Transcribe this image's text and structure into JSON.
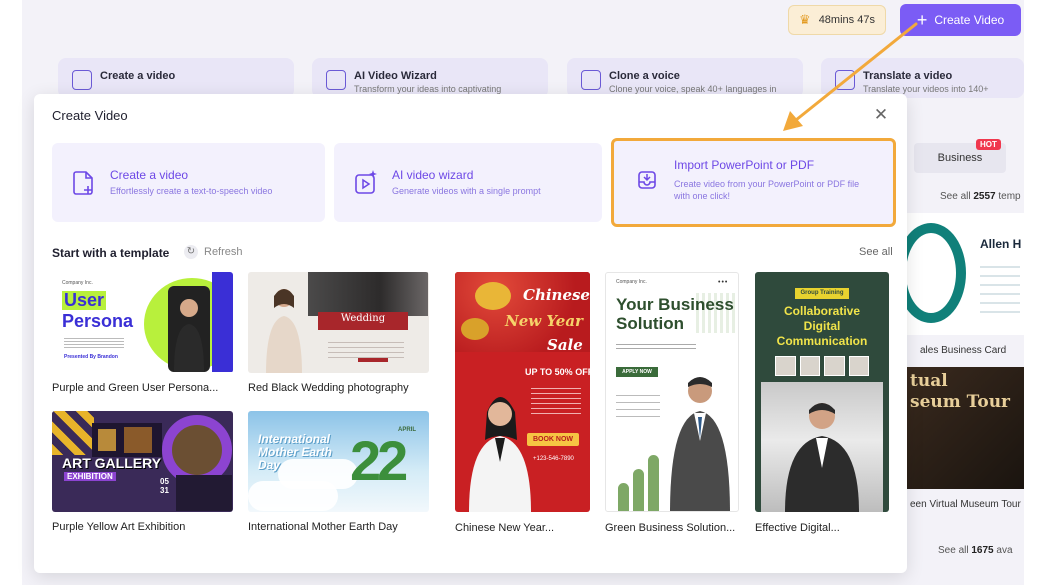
{
  "header": {
    "credits_label": "48mins 47s",
    "create_button_label": "Create Video"
  },
  "background_cards": [
    {
      "title": "Create a video",
      "subtitle": ""
    },
    {
      "title": "AI Video Wizard",
      "subtitle": "Transform your ideas into captivating"
    },
    {
      "title": "Clone a voice",
      "subtitle": "Clone your voice, speak 40+ languages in"
    },
    {
      "title": "Translate a video",
      "subtitle": "Translate your videos into 140+"
    }
  ],
  "background_right": {
    "tab_label": "Business",
    "hot_badge": "HOT",
    "see_all_prefix": "See all",
    "see_all_count": "2557",
    "see_all_suffix": "temp",
    "card1_name": "Allen H",
    "card1_caption": "ales Business Card",
    "card2_text": "tual\nseum Tour",
    "card2_caption": "een Virtual Museum Tour",
    "see_all2_prefix": "See all",
    "see_all2_count": "1675",
    "see_all2_suffix": "ava"
  },
  "modal": {
    "title": "Create Video",
    "options": [
      {
        "title": "Create a video",
        "subtitle": "Effortlessly create a text-to-speech video",
        "icon": "document-plus-icon"
      },
      {
        "title": "AI video wizard",
        "subtitle": "Generate videos with a single prompt",
        "icon": "magic-video-icon"
      },
      {
        "title": "Import PowerPoint or PDF",
        "subtitle": "Create video from your PowerPoint or PDF file with one click!",
        "icon": "import-tray-icon"
      }
    ],
    "section_title": "Start with a template",
    "refresh_label": "Refresh",
    "see_all_label": "See all",
    "templates": [
      {
        "caption": "Purple and Green User Persona...",
        "thumb": {
          "small": "Company Inc.",
          "line1": "User",
          "line2": "Persona",
          "presenter": "Presented By Brandon"
        }
      },
      {
        "caption": "Red Black Wedding photography",
        "thumb": {
          "band": "Wedding"
        }
      },
      {
        "caption": "Purple Yellow Art Exhibition",
        "thumb": {
          "title": "ART GALLERY",
          "sub": "EXHIBITION",
          "date": "05\n31"
        }
      },
      {
        "caption": "International Mother Earth Day",
        "thumb": {
          "title": "International\nMother Earth\nDay",
          "number": "22",
          "month": "APRIL"
        }
      },
      {
        "caption": "Chinese New Year...",
        "thumb": {
          "l1": "Chinese",
          "l2": "New Year",
          "l3": "Sale",
          "offer": "UP TO 50% OFF",
          "book": "BOOK NOW",
          "phone": "+123-546-7890"
        }
      },
      {
        "caption": "Green Business Solution...",
        "thumb": {
          "small": "Company Inc.",
          "title": "Your Business\nSolution",
          "apply": "APPLY NOW"
        }
      },
      {
        "caption": "Effective Digital...",
        "thumb": {
          "tag": "Group Training",
          "title": "Collaborative\nDigital\nCommunication"
        }
      }
    ]
  },
  "colors": {
    "accent": "#7b5cf5",
    "highlight_border": "#f2a93b",
    "annotation_arrow": "#f2a93b"
  }
}
